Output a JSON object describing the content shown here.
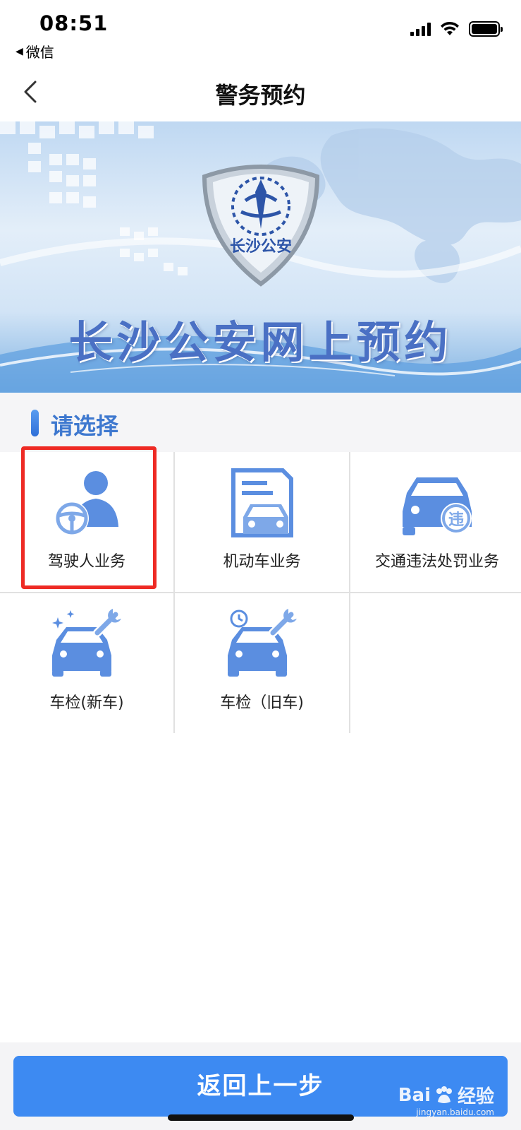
{
  "status_bar": {
    "time": "08:51",
    "back_app": "微信"
  },
  "nav": {
    "title": "警务预约"
  },
  "banner": {
    "emblem_text": "长沙公安",
    "title": "长沙公安网上预约"
  },
  "section": {
    "title": "请选择"
  },
  "services": [
    {
      "label": "驾驶人业务",
      "icon": "driver-icon"
    },
    {
      "label": "机动车业务",
      "icon": "vehicle-document-icon"
    },
    {
      "label": "交通违法处罚业务",
      "icon": "traffic-violation-icon",
      "badge": "违"
    },
    {
      "label": "车检(新车)",
      "icon": "new-car-inspection-icon"
    },
    {
      "label": "车检（旧车)",
      "icon": "old-car-inspection-icon"
    }
  ],
  "bottom": {
    "return_label": "返回上一步"
  },
  "watermark": {
    "brand": "Bai",
    "brand_suffix": "经验",
    "url": "jingyan.baidu.com"
  },
  "colors": {
    "accent": "#3d8af2",
    "icon_blue": "#5b8ee0",
    "highlight": "#ee2a24",
    "section_text": "#3e78cf"
  }
}
